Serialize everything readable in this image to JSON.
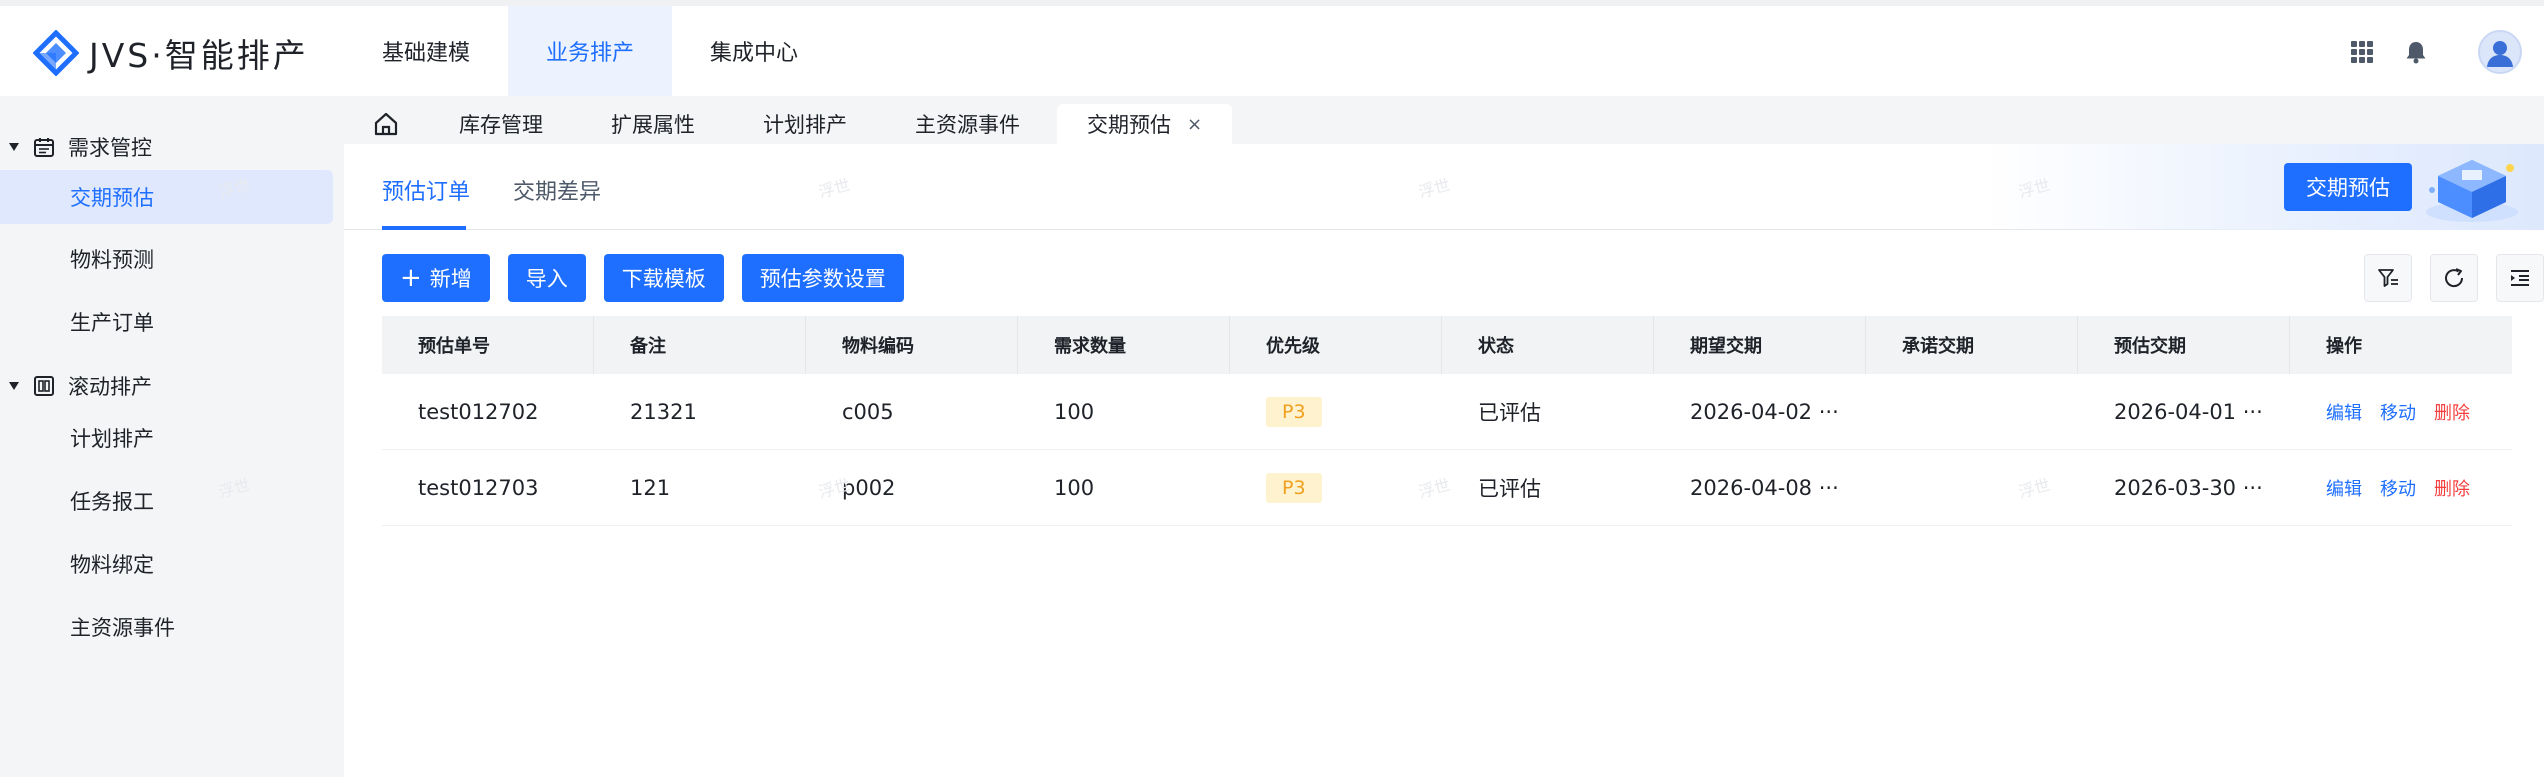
{
  "app": {
    "brand": "JVS·智能排产",
    "brand_color": "#1e6fff"
  },
  "topnav": {
    "items": [
      {
        "label": "基础建模"
      },
      {
        "label": "业务排产"
      },
      {
        "label": "集成中心"
      }
    ],
    "active": "业务排产",
    "icons": [
      "apps-grid-icon",
      "bell-icon",
      "user-avatar-icon"
    ]
  },
  "sidebar": {
    "groups": [
      {
        "label": "需求管控",
        "icon": "calendar-icon",
        "items": [
          "交期预估",
          "物料预测",
          "生产订单"
        ]
      },
      {
        "label": "滚动排产",
        "icon": "schedule-icon",
        "items": [
          "计划排产",
          "任务报工",
          "物料绑定",
          "主资源事件"
        ]
      }
    ],
    "active_item": "交期预估"
  },
  "tabbar": {
    "tabs": [
      "库存管理",
      "扩展属性",
      "计划排产",
      "主资源事件",
      "交期预估"
    ],
    "active": "交期预估",
    "close_glyph": "×"
  },
  "subtabs": {
    "items": [
      "预估订单",
      "交期差异"
    ],
    "active": "预估订单"
  },
  "banner": {
    "button_label": "交期预估"
  },
  "toolbar": {
    "add_label": "新增",
    "import_label": "导入",
    "download_label": "下载模板",
    "settings_label": "预估参数设置"
  },
  "table": {
    "columns": [
      "预估单号",
      "备注",
      "物料编码",
      "需求数量",
      "优先级",
      "状态",
      "期望交期",
      "承诺交期",
      "预估交期",
      "操作"
    ],
    "rows": [
      {
        "order_no": "test012702",
        "note": "21321",
        "material": "c005",
        "qty": "100",
        "priority": "P3",
        "status": "已评估",
        "expected": "2026-04-02 ···",
        "promised": "",
        "estimated": "2026-04-01 ···"
      },
      {
        "order_no": "test012703",
        "note": "121",
        "material": "p002",
        "qty": "100",
        "priority": "P3",
        "status": "已评估",
        "expected": "2026-04-08 ···",
        "promised": "",
        "estimated": "2026-03-30 ···"
      }
    ],
    "actions": {
      "edit": "编辑",
      "move": "移动",
      "delete": "删除"
    }
  },
  "watermark": "浮世"
}
